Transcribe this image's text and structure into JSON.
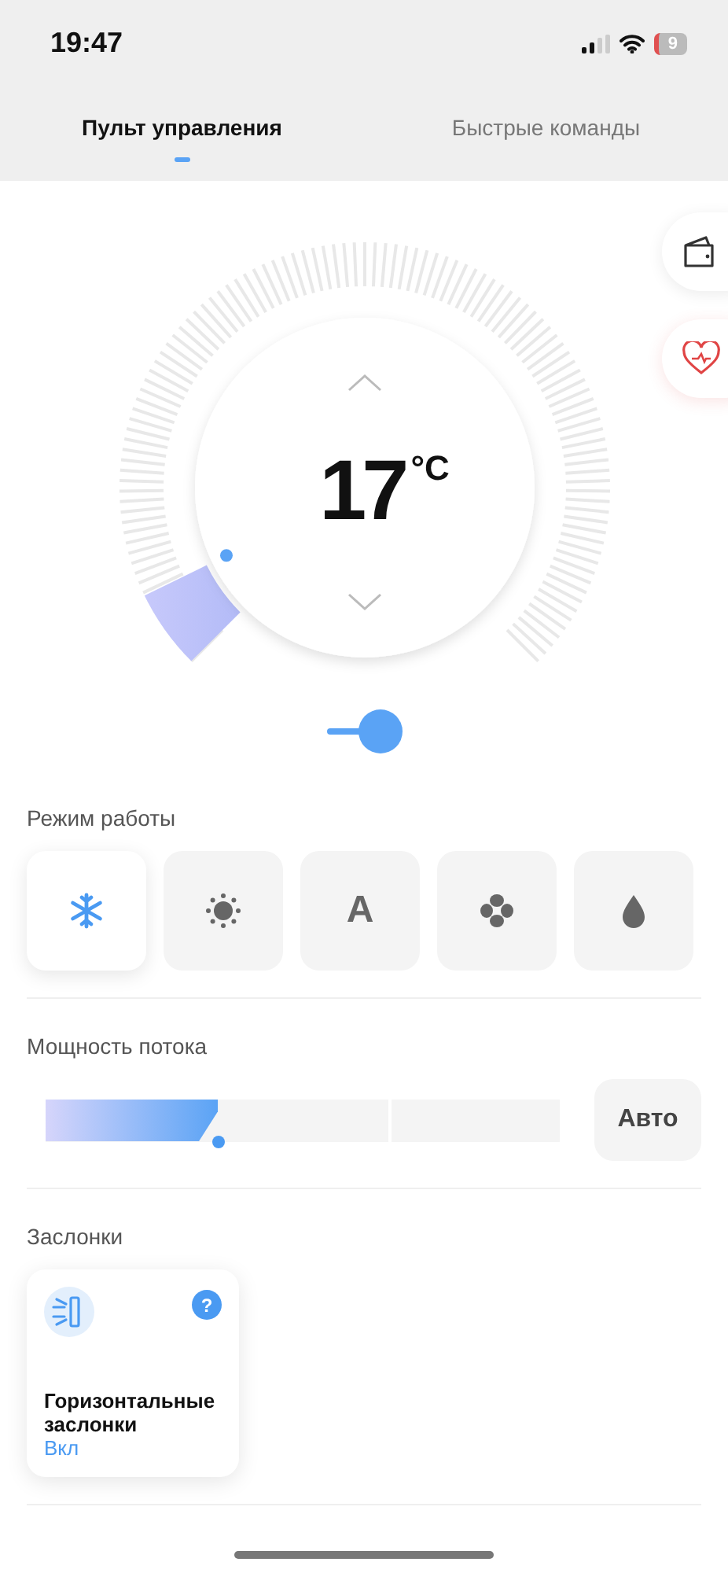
{
  "status_bar": {
    "time": "19:47",
    "battery": "9"
  },
  "tabs": [
    {
      "label": "Пульт управления",
      "selected": true
    },
    {
      "label": "Быстрые команды",
      "selected": false
    }
  ],
  "thermostat": {
    "temperature": "17",
    "unit": "°C"
  },
  "power_toggle": {
    "on": true
  },
  "mode_section": {
    "title": "Режим работы",
    "modes": [
      {
        "kind": "cool",
        "selected": true
      },
      {
        "kind": "heat",
        "selected": false
      },
      {
        "kind": "auto",
        "label": "A",
        "selected": false
      },
      {
        "kind": "fan",
        "selected": false
      },
      {
        "kind": "dry",
        "selected": false
      }
    ]
  },
  "flow_section": {
    "title": "Мощность потока",
    "level": 0.335,
    "auto_button": "Авто"
  },
  "louvers_section": {
    "title": "Заслонки",
    "cards": [
      {
        "title": "Горизонтальные заслонки",
        "status": "Вкл",
        "on": true,
        "help": "?"
      }
    ]
  }
}
